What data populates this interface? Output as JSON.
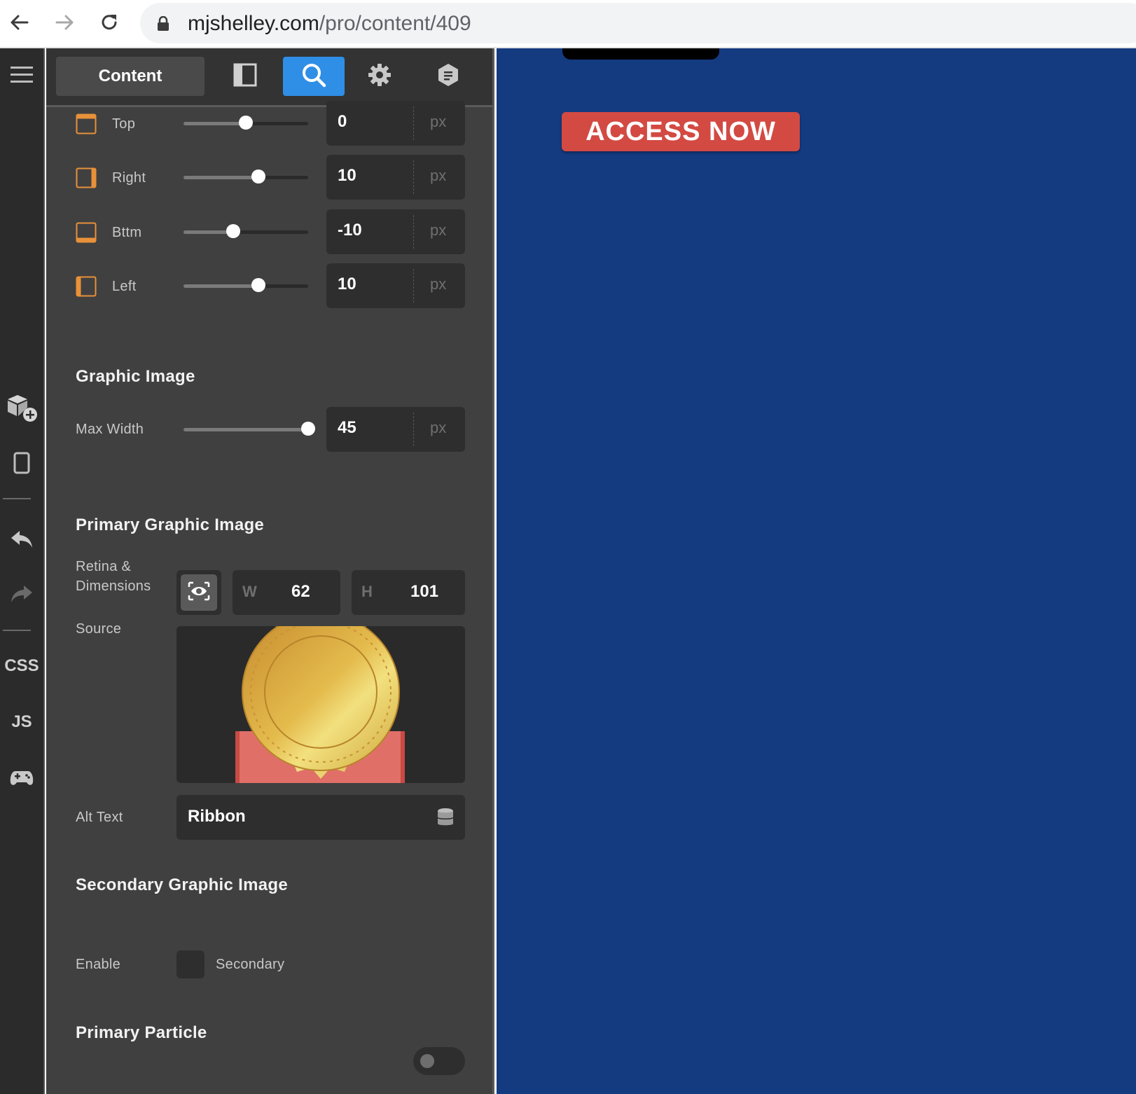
{
  "browser": {
    "url_domain": "mjshelley.com",
    "url_path": "/pro/content/409"
  },
  "rail": {
    "css_label": "CSS",
    "js_label": "JS"
  },
  "toolbar": {
    "content_tab_label": "Content"
  },
  "margins": [
    {
      "label": "Top",
      "value": "0",
      "unit": "px",
      "slider_fraction": 0.5
    },
    {
      "label": "Right",
      "value": "10",
      "unit": "px",
      "slider_fraction": 0.6
    },
    {
      "label": "Bttm",
      "value": "-10",
      "unit": "px",
      "slider_fraction": 0.4
    },
    {
      "label": "Left",
      "value": "10",
      "unit": "px",
      "slider_fraction": 0.6
    }
  ],
  "graphic_image": {
    "title": "Graphic Image",
    "max_width_label": "Max Width",
    "max_width_value": "45",
    "max_width_unit": "px",
    "slider_fraction": 1.0
  },
  "primary_graphic": {
    "title": "Primary Graphic Image",
    "retina_label": "Retina & Dimensions",
    "w_letter": "W",
    "w_value": "62",
    "h_letter": "H",
    "h_value": "101",
    "source_label": "Source",
    "alt_label": "Alt Text",
    "alt_value": "Ribbon"
  },
  "secondary_graphic": {
    "title": "Secondary Graphic Image",
    "enable_label": "Enable",
    "checkbox_label": "Secondary"
  },
  "primary_particle": {
    "title": "Primary Particle"
  },
  "canvas": {
    "cta_label": "ACCESS NOW"
  },
  "colors": {
    "accent_blue": "#2f8ee6",
    "canvas_bg": "#143a80",
    "cta_red": "#d34a43",
    "edge_icon_orange": "#e8913a"
  },
  "icons": [
    "back-arrow-icon",
    "forward-arrow-icon",
    "reload-icon",
    "lock-icon",
    "hamburger-menu-icon",
    "add-block-icon",
    "tablet-icon",
    "undo-icon",
    "redo-icon",
    "gamepad-icon",
    "layout-icon",
    "search-icon",
    "gear-icon",
    "hexagon-icon",
    "eye-icon",
    "database-icon"
  ]
}
